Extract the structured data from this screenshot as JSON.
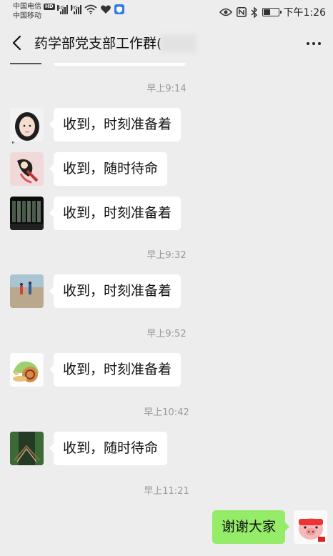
{
  "status_bar": {
    "carrier1": "中国电信",
    "hd": "HD",
    "carrier2": "中国移动",
    "signal1_label": "4G",
    "signal2_label": "2G",
    "time": "下午1:26",
    "battery_level": 0.5,
    "icons": [
      "signal-icon",
      "wifi-icon",
      "heart-icon",
      "shield-app-icon",
      "eye-icon",
      "nfc-icon",
      "bluetooth-icon",
      "battery-icon"
    ]
  },
  "header": {
    "back_icon": "chevron-left-icon",
    "title": "药学部党支部工作群(",
    "more_icon": "more-dots-icon"
  },
  "messages": [
    {
      "type": "time",
      "text": "早上9:14"
    },
    {
      "type": "in",
      "avatar": "avatar-girl",
      "text": "收到，时刻准备着"
    },
    {
      "type": "in",
      "avatar": "avatar-cartoon-pink",
      "text": "收到，随时待命"
    },
    {
      "type": "in",
      "avatar": "avatar-dark-building",
      "text": "收到，时刻准备着"
    },
    {
      "type": "time",
      "text": "早上9:32"
    },
    {
      "type": "in",
      "avatar": "avatar-beach",
      "text": "收到，时刻准备着"
    },
    {
      "type": "time",
      "text": "早上9:52"
    },
    {
      "type": "in",
      "avatar": "avatar-snail",
      "text": "收到，时刻准备着"
    },
    {
      "type": "time",
      "text": "早上10:42"
    },
    {
      "type": "in",
      "avatar": "avatar-bridge",
      "text": "收到，随时待命"
    },
    {
      "type": "time",
      "text": "早上11:21"
    },
    {
      "type": "out",
      "avatar": "avatar-pig",
      "text": "谢谢大家"
    }
  ],
  "colors": {
    "background": "#ededed",
    "bubble_in": "#ffffff",
    "bubble_out": "#95ec69",
    "timestamp": "#999999"
  }
}
